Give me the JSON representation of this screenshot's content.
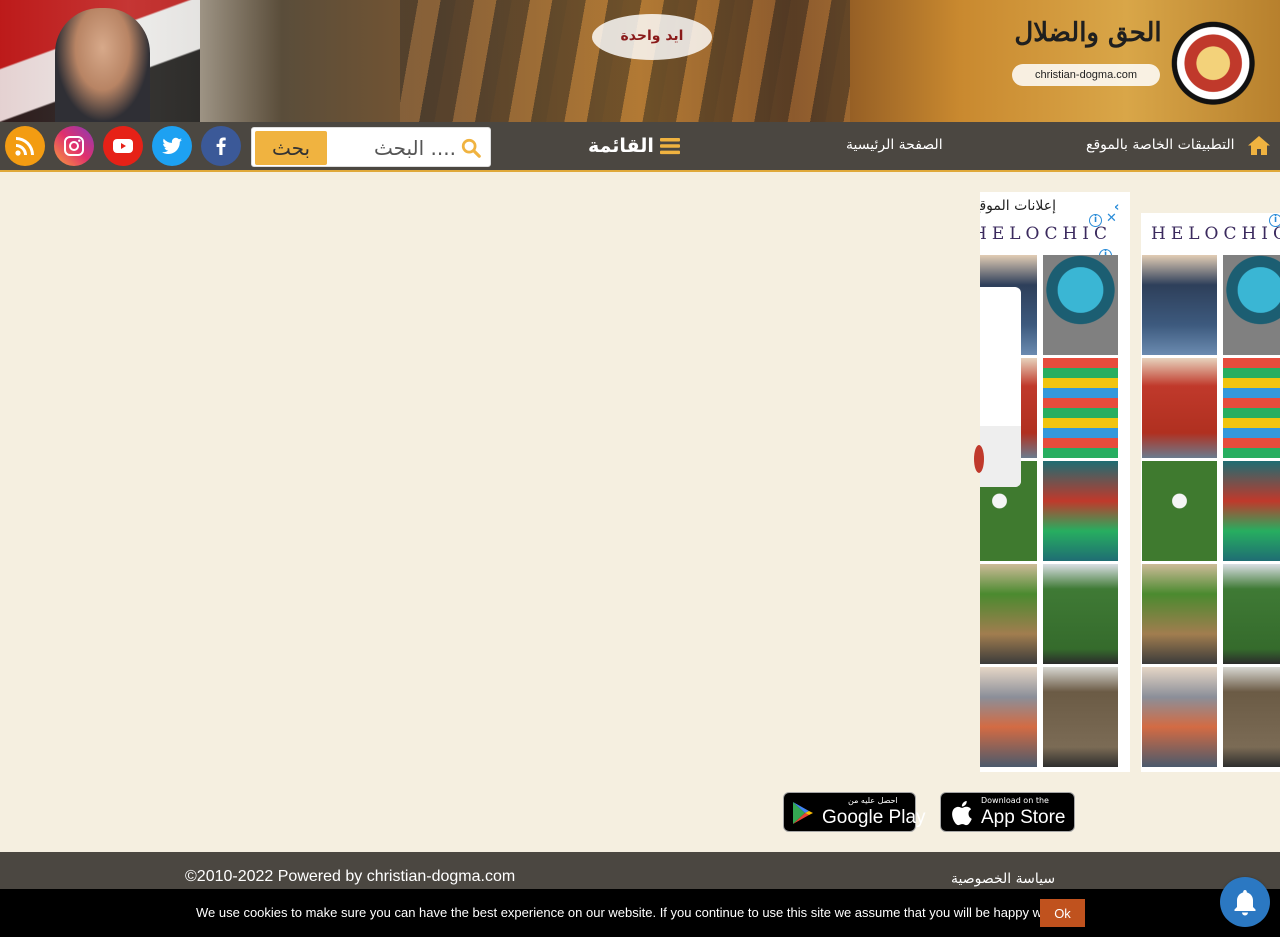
{
  "banner": {
    "slogan": "ايد واحدة",
    "logo_title": "الحق والضلال",
    "logo_site": "christian-dogma.com"
  },
  "navbar": {
    "search": {
      "button_label": "بحث",
      "placeholder": "البحث ...."
    },
    "menu_label": "القائمة",
    "links": [
      "الصفحة الرئيسية",
      "التطبيقات الخاصة بالموقع"
    ],
    "social": [
      "facebook-icon",
      "twitter-icon",
      "youtube-icon",
      "instagram-icon",
      "rss-icon"
    ]
  },
  "ads": {
    "panel_title": "إعلانات الموقع",
    "brand": "HELOCHIC",
    "close": "‹",
    "info": "i"
  },
  "apps": {
    "google_play": {
      "small": "احصل عليه من",
      "big": "Google Play"
    },
    "app_store": {
      "small": "Download on the",
      "big": "App Store"
    }
  },
  "footer": {
    "copyright": "©2010-2022 Powered by christian-dogma.com",
    "link": "سياسة الخصوصية"
  },
  "cookie": {
    "text": "We use cookies to make sure you can have the best experience on our website. If you continue to use this site we assume that you will be happy with it.",
    "ok_label": "Ok"
  },
  "colors": {
    "navbar_bg": "#4b4741",
    "accent": "#f0b340",
    "page_bg": "#f5efe0",
    "facebook": "#3b5998",
    "twitter": "#1da1f2",
    "youtube": "#e62117",
    "rss": "#f39c12",
    "notify_bell": "#2b78c2"
  }
}
